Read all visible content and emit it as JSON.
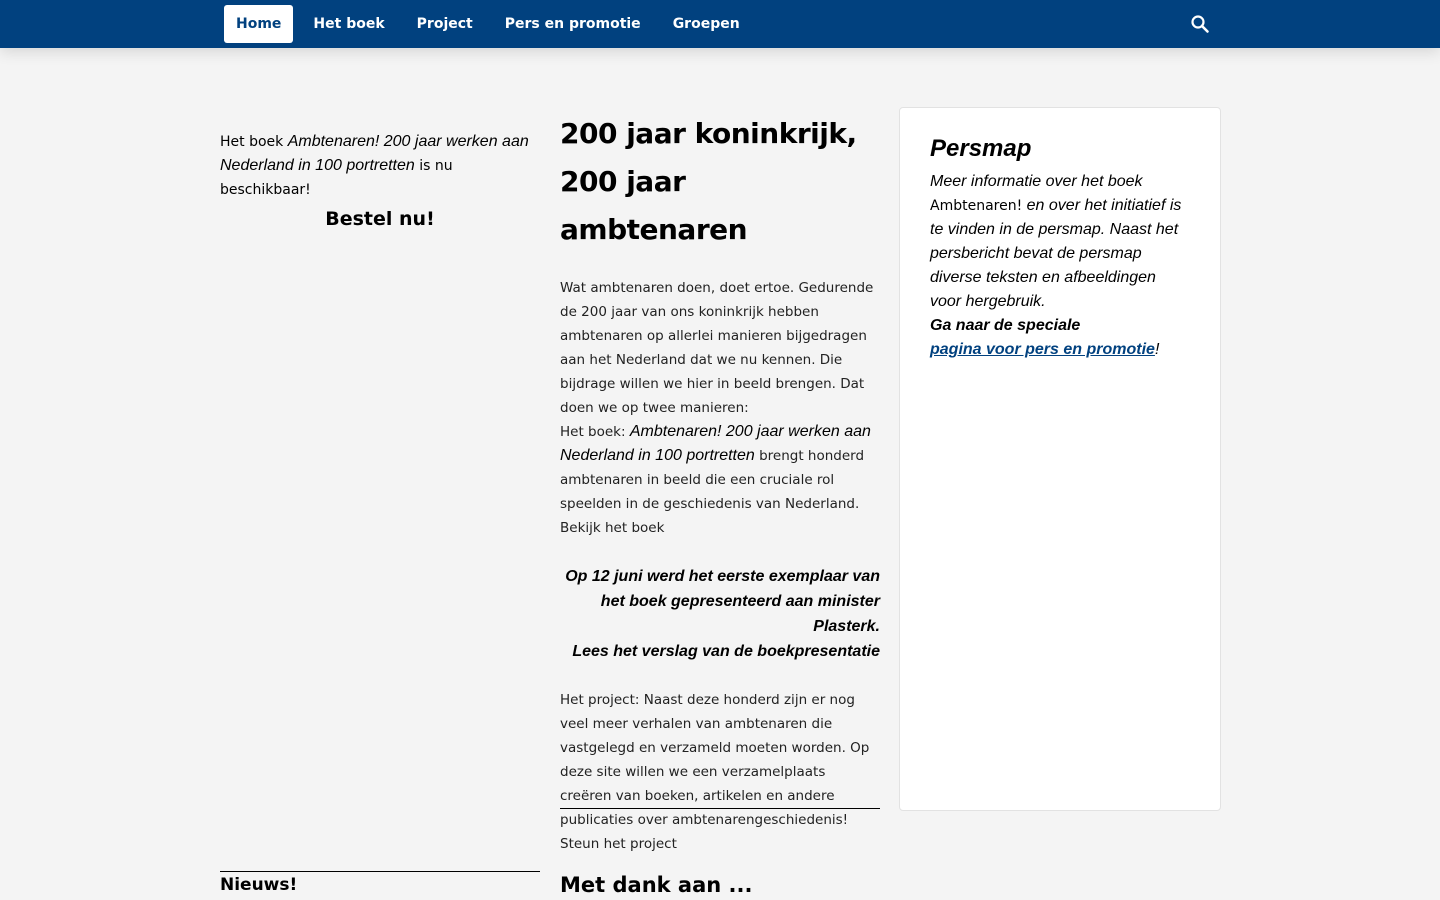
{
  "nav": {
    "items": [
      {
        "label": "Home",
        "active": true
      },
      {
        "label": "Het boek",
        "active": false
      },
      {
        "label": "Project",
        "active": false
      },
      {
        "label": "Pers en promotie",
        "active": false
      },
      {
        "label": "Groepen",
        "active": false
      }
    ],
    "search_icon": "search-icon"
  },
  "left": {
    "intro_prefix": "Het boek ",
    "book_title": "Ambtenaren! 200 jaar werken aan Nederland in 100 portretten",
    "intro_suffix": " is nu beschikbaar!",
    "order_label": "Bestel nu!",
    "news_heading": "Nieuws!"
  },
  "main": {
    "title": "200 jaar koninkrijk, 200 jaar ambtenaren",
    "p1": "Wat ambtenaren doen, doet ertoe. Gedurende de 200 jaar van ons koninkrijk hebben ambtenaren op allerlei manieren bijgedragen aan het Nederland dat we nu kennen. Die bijdrage willen we hier in beeld brengen. Dat doen we op twee manieren:",
    "book_prefix": "Het boek: ",
    "book_title": "Ambtenaren! 200 jaar werken aan Nederland in 100 portretten",
    "book_suffix": " brengt honderd ambtenaren in beeld die een cruciale rol speelden in de geschiedenis van Nederland. Bekijk het boek",
    "event_line": "Op 12 juni werd het eerste exemplaar van het boek gepresenteerd aan minister Plasterk.",
    "report_link": "Lees het verslag van de boekpresentatie",
    "p3": "Het project: Naast deze honderd zijn er nog veel meer verhalen van ambtenaren die vastgelegd en verzameld moeten worden. Op deze site willen we een verzamelplaats creëren van boeken, artikelen en andere publicaties over ambtenarengeschiedenis! Steun het project",
    "thanks_heading": "Met dank aan ..."
  },
  "persmap": {
    "title": "Persmap",
    "text_a": "Meer informatie over het boek ",
    "book_name": "Ambtenaren!",
    "text_b": " en over het initiatief is te vinden in de persmap. Naast het persbericht bevat de persmap diverse teksten en afbeeldingen voor hergebruik.",
    "goto_label": "Ga naar de speciale",
    "link_label": "pagina voor pers en promotie",
    "exclamation": "!"
  },
  "colors": {
    "header_bg": "#01417f",
    "page_bg": "#f4f4f4",
    "link": "#01417f"
  }
}
